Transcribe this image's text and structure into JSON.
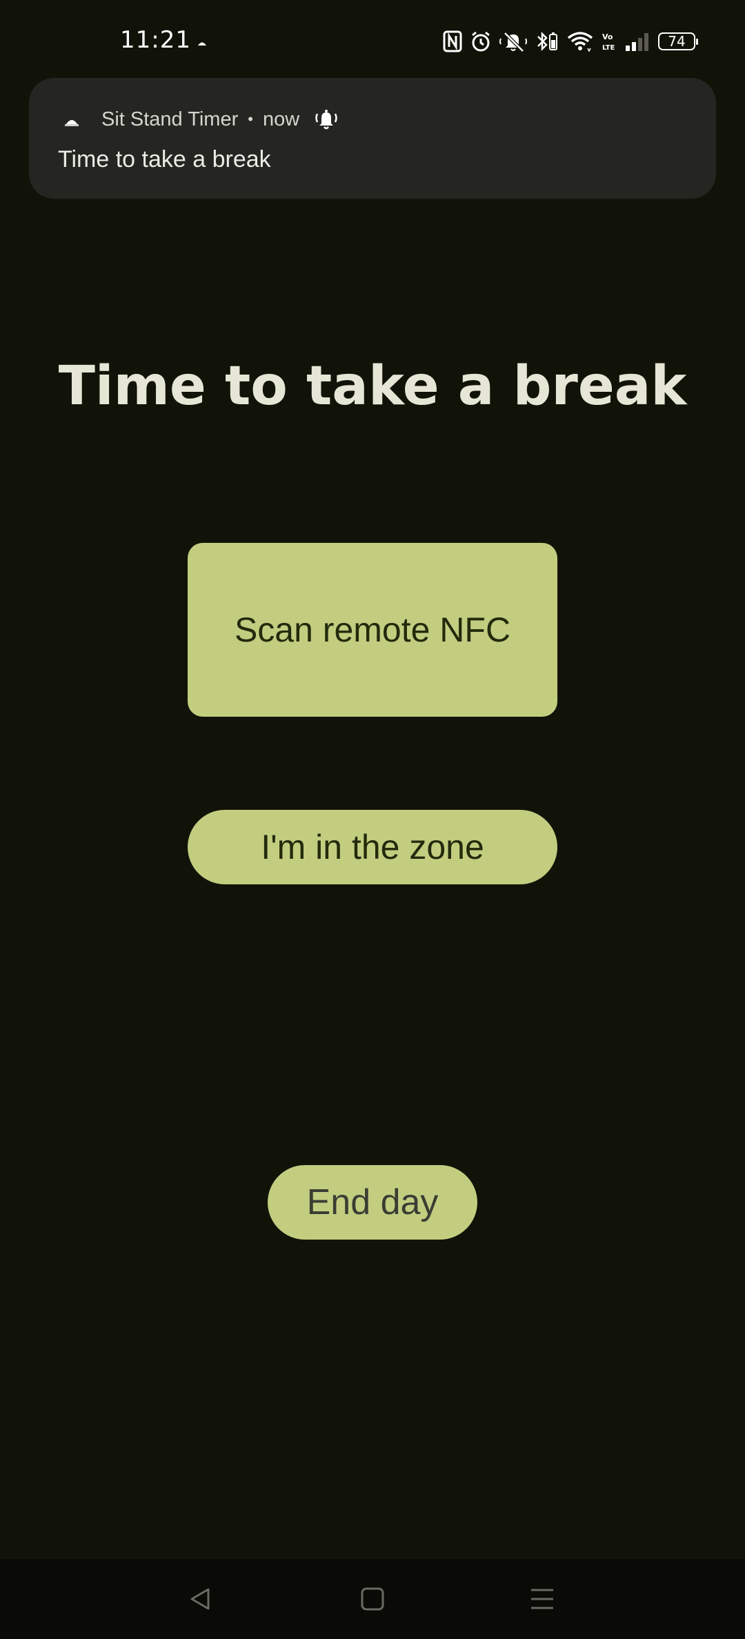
{
  "status_bar": {
    "time": "11:21",
    "battery_level": "74",
    "icons": [
      "nfc-icon",
      "alarm-icon",
      "silent-icon",
      "bluetooth-battery-icon",
      "wifi-icon",
      "volte-icon",
      "signal-icon",
      "battery-icon"
    ]
  },
  "notification": {
    "app_name": "Sit Stand Timer",
    "separator": "•",
    "time": "now",
    "text": "Time to take a break"
  },
  "main": {
    "title": "Time to take a break",
    "scan_button_label": "Scan remote NFC",
    "zone_button_label": "I'm in the zone",
    "end_day_button_label": "End day"
  },
  "colors": {
    "background": "#121308",
    "button": "#c2cd80",
    "button_text": "#232a0c",
    "notification_bg": "#252622",
    "title": "#e6e6d6"
  }
}
